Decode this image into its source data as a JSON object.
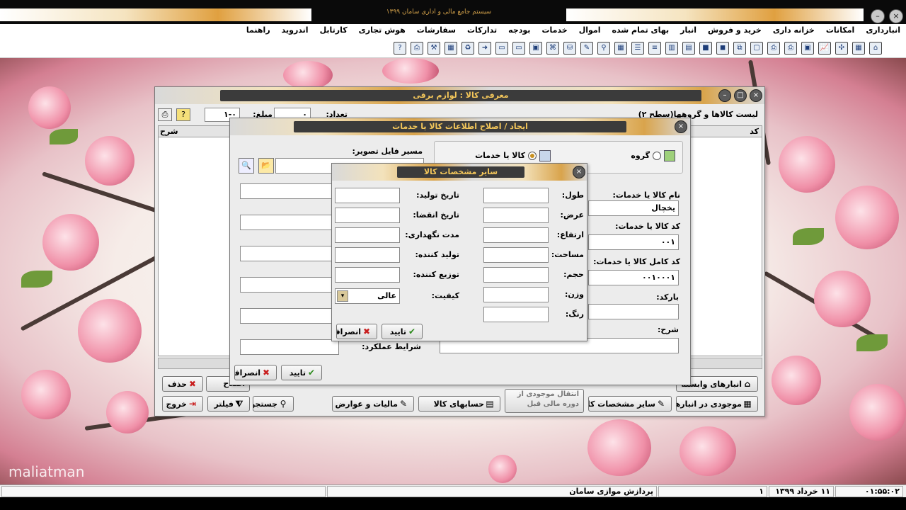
{
  "app": {
    "title": "سیستم جامع مالی و اداری سامان ۱۳۹۹",
    "watermark": "maliatman"
  },
  "menu": [
    "انبارداری",
    "امکانات",
    "خزانه داری",
    "خرید و فروش",
    "انبار",
    "بهای تمام شده",
    "اموال",
    "خدمات",
    "بودجه",
    "تدارکات",
    "سفارشات",
    "هوش تجاری",
    "کارتابل",
    "اندروید",
    "راهنما"
  ],
  "toolbar_icons": [
    "help-icon",
    "print-icon",
    "tools-icon",
    "calc-icon",
    "recycle-icon",
    "arrow-right-icon",
    "doc-icon",
    "docs-icon",
    "monitor-icon",
    "network-icon",
    "database-icon",
    "pencil-icon",
    "search-icon",
    "grid-icon",
    "table-icon",
    "list-icon",
    "columns-icon",
    "report-icon",
    "box-icon",
    "cube-icon",
    "copy-icon",
    "window-icon",
    "print2-icon",
    "print3-icon",
    "package-icon",
    "chart-icon",
    "tree-icon",
    "building-icon",
    "home-icon"
  ],
  "back_window": {
    "title": "معرفی کالا : لوازم برقی",
    "list_label": "لیست کالاها و گروهها(سطح ۲)",
    "count_label": "تعداد:",
    "count_value": "۰",
    "sum_label": "مبلغ:",
    "page_value": "۱-۰",
    "col_code": "کد",
    "col_other": "شرح",
    "buttons": {
      "depot": "انبارهای وابسته",
      "delete": "حذف",
      "fix": "اصلاح",
      "stock": "موجودی در انبارها",
      "specs": "سایر مشخصات کالا",
      "transfer": "انتقال موجودی از دوره مالی قبل",
      "accounts": "حسابهای کالا",
      "tax": "مالیات و عوارض",
      "search": "جستجو",
      "filter": "فیلتر",
      "exit": "خروج"
    }
  },
  "mid_window": {
    "title": "ایجاد / اصلاح اطلاعات کالا یا خدمات",
    "radio_group": "گروه",
    "radio_item": "کالا یا خدمات",
    "image_path_label": "مسیر فایل تصویر:",
    "name_label": "نام کالا یا خدمات:",
    "name_value": "یخچال",
    "code_label": "کد کالا یا خدمات:",
    "code_value": "۰۰۱",
    "fullcode_label": "کد کامل کالا یا خدمات:",
    "fullcode_value": "۰۰۱۰۰۰۱",
    "barcode_label": "بارکد:",
    "desc_label": "شرح:",
    "perf_label": "شرایط عملکرد:",
    "ok": "تایید",
    "cancel": "انصراف"
  },
  "dialog": {
    "title": "سایر مشخصات کالا",
    "right_fields": [
      {
        "label": "طول:",
        "value": ""
      },
      {
        "label": "عرض:",
        "value": ""
      },
      {
        "label": "ارتفاع:",
        "value": ""
      },
      {
        "label": "مساحت:",
        "value": ""
      },
      {
        "label": "حجم:",
        "value": ""
      },
      {
        "label": "وزن:",
        "value": ""
      },
      {
        "label": "رنگ:",
        "value": ""
      }
    ],
    "left_fields": [
      {
        "label": "تاریخ تولید:",
        "value": ""
      },
      {
        "label": "تاریخ انقضا:",
        "value": ""
      },
      {
        "label": "مدت نگهداری:",
        "value": ""
      },
      {
        "label": "تولید کننده:",
        "value": ""
      },
      {
        "label": "توزیع کننده:",
        "value": ""
      }
    ],
    "quality_label": "کیفیت:",
    "quality_value": "عالی",
    "ok": "تایید",
    "cancel": "انصراف"
  },
  "status": {
    "time": "۰۱:۵۵:۰۲",
    "date": "۱۱ خرداد ۱۳۹۹",
    "num": "۱",
    "company": "پردازش موازی سامان"
  }
}
